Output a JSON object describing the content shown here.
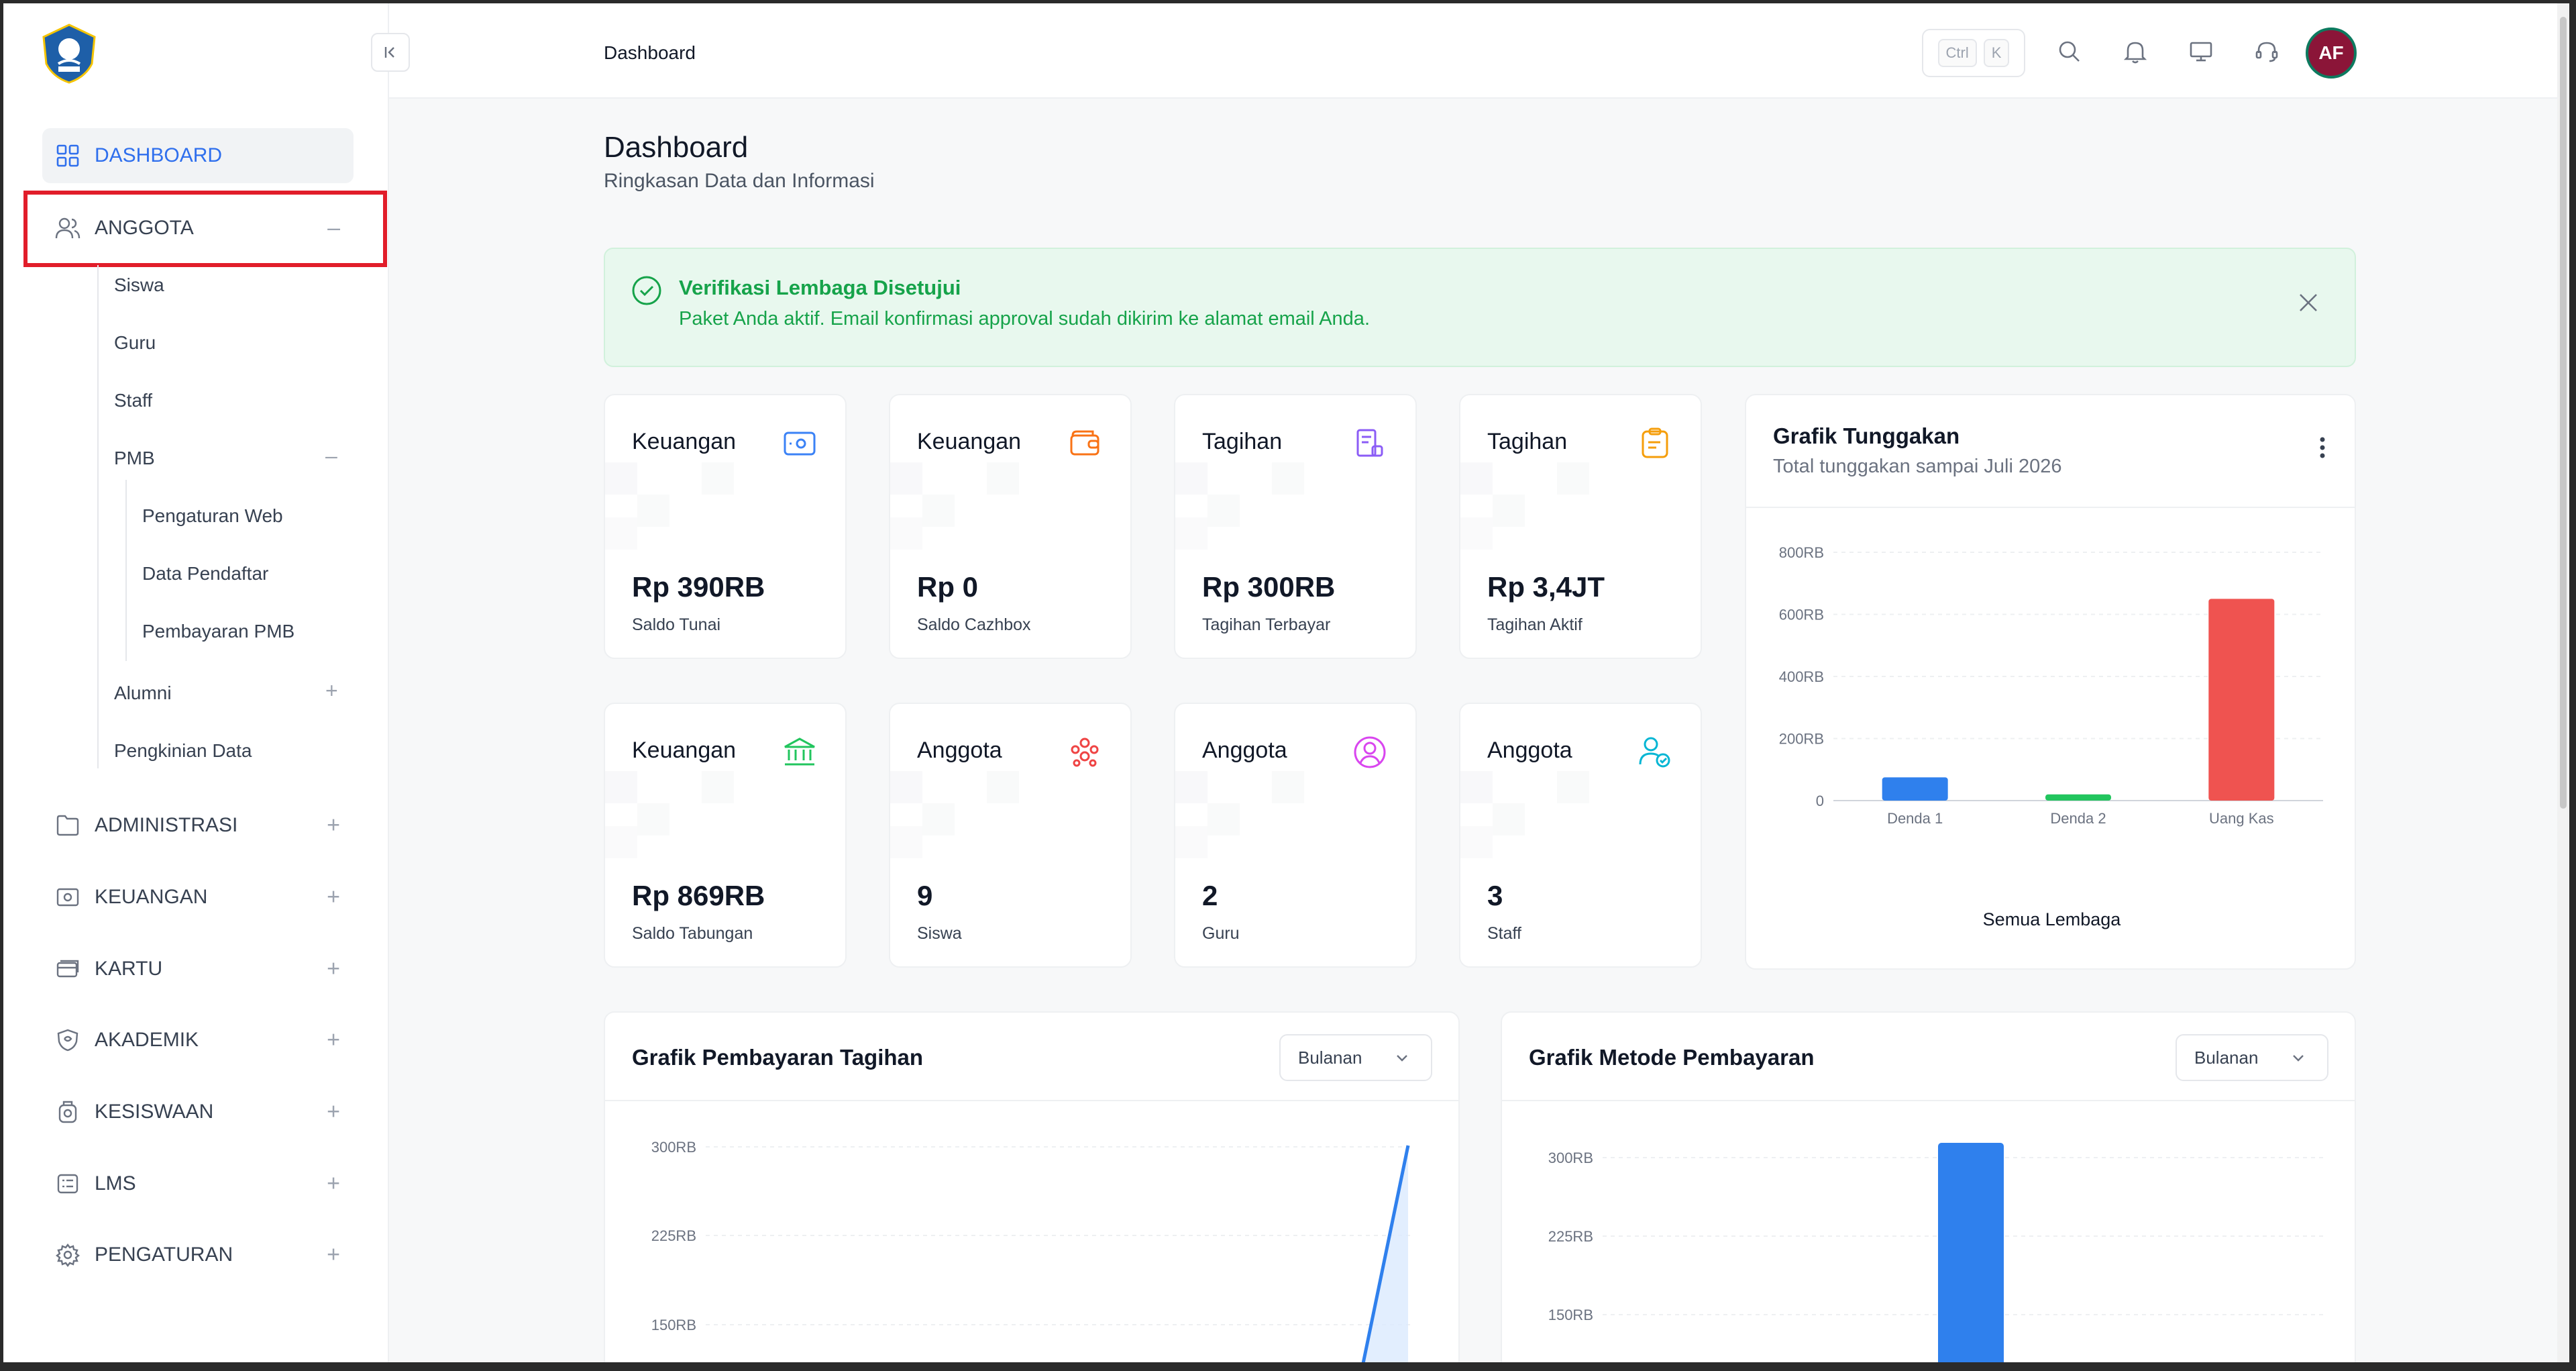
{
  "topbar": {
    "breadcrumb": "Dashboard",
    "shortcut_keys": [
      "Ctrl",
      "K"
    ],
    "avatar_initials": "AF"
  },
  "sidebar": {
    "items": [
      {
        "label": "DASHBOARD",
        "icon": "dashboard-icon",
        "active": true
      },
      {
        "label": "ANGGOTA",
        "icon": "users-icon",
        "expanded": true
      },
      {
        "label": "ADMINISTRASI",
        "icon": "folder-icon"
      },
      {
        "label": "KEUANGAN",
        "icon": "cash-icon"
      },
      {
        "label": "KARTU",
        "icon": "card-icon"
      },
      {
        "label": "AKADEMIK",
        "icon": "shield-icon"
      },
      {
        "label": "KESISWAAN",
        "icon": "student-icon"
      },
      {
        "label": "LMS",
        "icon": "list-icon"
      },
      {
        "label": "PENGATURAN",
        "icon": "gear-icon"
      }
    ],
    "anggota_sub": [
      "Siswa",
      "Guru",
      "Staff",
      "PMB",
      "Alumni",
      "Pengkinian Data"
    ],
    "pmb_sub": [
      "Pengaturan Web",
      "Data Pendaftar",
      "Pembayaran PMB"
    ]
  },
  "page": {
    "title": "Dashboard",
    "subtitle": "Ringkasan Data dan Informasi"
  },
  "alert": {
    "title": "Verifikasi Lembaga Disetujui",
    "message": "Paket Anda aktif. Email konfirmasi approval sudah dikirim ke alamat email Anda."
  },
  "cards": [
    {
      "category": "Keuangan",
      "value": "Rp 390RB",
      "label": "Saldo Tunai",
      "icon": "wallet-cash-icon",
      "color": "#3b82f6"
    },
    {
      "category": "Keuangan",
      "value": "Rp 0",
      "label": "Saldo Cazhbox",
      "icon": "wallet-icon",
      "color": "#f97316"
    },
    {
      "category": "Tagihan",
      "value": "Rp 300RB",
      "label": "Tagihan Terbayar",
      "icon": "receipt-icon",
      "color": "#8b5cf6"
    },
    {
      "category": "Tagihan",
      "value": "Rp 3,4JT",
      "label": "Tagihan Aktif",
      "icon": "clipboard-icon",
      "color": "#f59e0b"
    },
    {
      "category": "Keuangan",
      "value": "Rp 869RB",
      "label": "Saldo Tabungan",
      "icon": "bank-icon",
      "color": "#22c55e"
    },
    {
      "category": "Anggota",
      "value": "9",
      "label": "Siswa",
      "icon": "group-icon",
      "color": "#ef4444"
    },
    {
      "category": "Anggota",
      "value": "2",
      "label": "Guru",
      "icon": "user-circle-icon",
      "color": "#d946ef"
    },
    {
      "category": "Anggota",
      "value": "3",
      "label": "Staff",
      "icon": "user-check-icon",
      "color": "#06b6d4"
    }
  ],
  "tunggakan": {
    "title": "Grafik Tunggakan",
    "subtitle": "Total tunggakan sampai Juli 2026",
    "footer": "Semua Lembaga"
  },
  "pembayaran": {
    "title": "Grafik Pembayaran Tagihan",
    "select": "Bulanan"
  },
  "metode": {
    "title": "Grafik Metode Pembayaran",
    "select": "Bulanan"
  },
  "chart_data": [
    {
      "type": "bar",
      "title": "Grafik Tunggakan",
      "categories": [
        "Denda 1",
        "Denda 2",
        "Uang Kas"
      ],
      "values": [
        75000,
        20000,
        650000
      ],
      "colors": [
        "#2f80ed",
        "#22c55e",
        "#ef5350"
      ],
      "yticks": [
        "0",
        "200RB",
        "400RB",
        "600RB",
        "800RB"
      ],
      "ylim": [
        0,
        800000
      ]
    },
    {
      "type": "area",
      "title": "Grafik Pembayaran Tagihan",
      "yticks": [
        "150RB",
        "225RB",
        "300RB"
      ],
      "y_end": 300000,
      "color": "#2f80ed"
    },
    {
      "type": "bar",
      "title": "Grafik Metode Pembayaran",
      "yticks": [
        "150RB",
        "225RB",
        "300RB"
      ],
      "values": [
        300000
      ],
      "color": "#2f80ed"
    }
  ]
}
